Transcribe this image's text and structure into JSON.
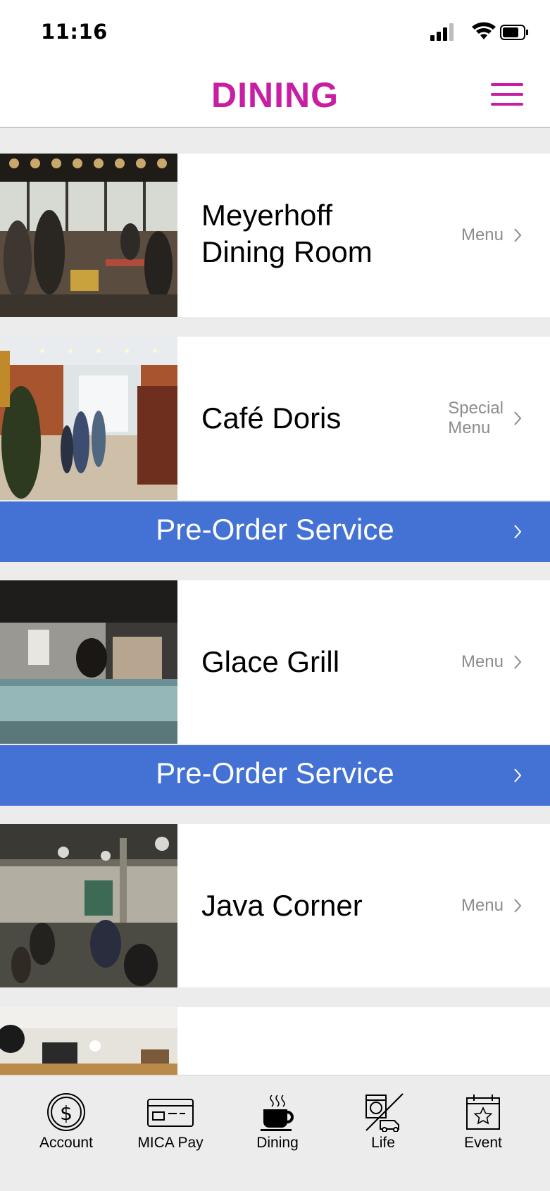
{
  "status_bar": {
    "time": "11:16"
  },
  "header": {
    "title": "DINING",
    "menu_icon": "hamburger-menu-icon"
  },
  "colors": {
    "accent": "#c81ea4",
    "preorder_bg": "#4472d4",
    "background": "#ececec",
    "muted_text": "#8c8c8c"
  },
  "venues": [
    {
      "name_lines": [
        "Meyerhoff",
        "Dining Room"
      ],
      "link_lines": [
        "Menu"
      ],
      "photo": "dining-room-photo"
    },
    {
      "name_lines": [
        "Café Doris"
      ],
      "link_lines": [
        "Special",
        "Menu"
      ],
      "photo": "cafe-photo",
      "preorder_label": "Pre-Order Service"
    },
    {
      "name_lines": [
        "Glace Grill"
      ],
      "link_lines": [
        "Menu"
      ],
      "photo": "grill-photo",
      "preorder_label": "Pre-Order Service"
    },
    {
      "name_lines": [
        "Java Corner"
      ],
      "link_lines": [
        "Menu"
      ],
      "photo": "java-corner-photo"
    },
    {
      "name_lines": [
        ""
      ],
      "link_lines": [],
      "photo": "lounge-photo"
    }
  ],
  "tabbar": {
    "tabs": [
      {
        "label": "Account",
        "icon": "dollar-coin-icon"
      },
      {
        "label": "MICA Pay",
        "icon": "credit-card-icon"
      },
      {
        "label": "Dining",
        "icon": "coffee-cup-icon",
        "active": true
      },
      {
        "label": "Life",
        "icon": "laundry-truck-icon"
      },
      {
        "label": "Event",
        "icon": "calendar-star-icon"
      }
    ]
  }
}
